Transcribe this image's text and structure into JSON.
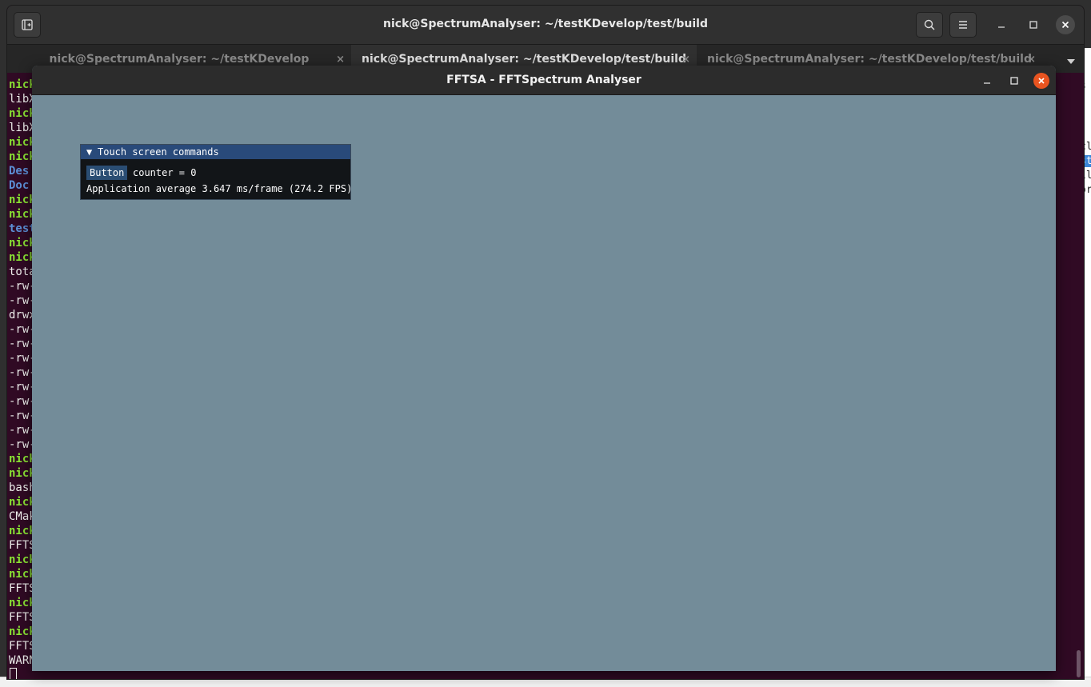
{
  "terminal": {
    "title": "nick@SpectrumAnalyser: ~/testKDevelop/test/build",
    "tabs": [
      {
        "label": "nick@SpectrumAnalyser: ~/testKDevelop",
        "active": false
      },
      {
        "label": "nick@SpectrumAnalyser: ~/testKDevelop/test/build",
        "active": true
      },
      {
        "label": "nick@SpectrumAnalyser: ~/testKDevelop/test/build",
        "active": false
      }
    ],
    "tab_close_glyph": "×",
    "lines": [
      {
        "text": "nick",
        "color": "green"
      },
      {
        "text": "libX",
        "color": "white"
      },
      {
        "text": "nick",
        "color": "green"
      },
      {
        "text": "libX",
        "color": "white"
      },
      {
        "text": "nick",
        "color": "green"
      },
      {
        "text": "nick",
        "color": "green"
      },
      {
        "text": " Des",
        "color": "blue"
      },
      {
        "text": " Doc",
        "color": "blue"
      },
      {
        "text": "nick",
        "color": "green"
      },
      {
        "text": "nick",
        "color": "green"
      },
      {
        "text": "test",
        "color": "blue"
      },
      {
        "text": "nick",
        "color": "green"
      },
      {
        "text": "nick",
        "color": "green"
      },
      {
        "text": "tota",
        "color": "white"
      },
      {
        "text": "-rw-",
        "color": "white"
      },
      {
        "text": "-rw-",
        "color": "white"
      },
      {
        "text": "drwx",
        "color": "white"
      },
      {
        "text": "-rw-",
        "color": "white"
      },
      {
        "text": "-rw-",
        "color": "white"
      },
      {
        "text": "-rw-",
        "color": "white"
      },
      {
        "text": "-rw-",
        "color": "white"
      },
      {
        "text": "-rw-",
        "color": "white"
      },
      {
        "text": "-rw-",
        "color": "white"
      },
      {
        "text": "-rw-",
        "color": "white"
      },
      {
        "text": "-rw-",
        "color": "white"
      },
      {
        "text": "-rw-",
        "color": "white"
      },
      {
        "text": "nick",
        "color": "green"
      },
      {
        "text": "nick",
        "color": "green"
      },
      {
        "text": "bash",
        "color": "white"
      },
      {
        "text": "nick",
        "color": "green"
      },
      {
        "text": "CMak",
        "color": "white"
      },
      {
        "text": "nick",
        "color": "green"
      },
      {
        "text": "FFTS",
        "color": "white"
      },
      {
        "text": "nick",
        "color": "green"
      },
      {
        "text": "nick",
        "color": "green"
      },
      {
        "text": "FFTS",
        "color": "white"
      },
      {
        "text": "nick",
        "color": "green"
      },
      {
        "text": "FFTS",
        "color": "white"
      },
      {
        "text": "nick",
        "color": "green"
      },
      {
        "text": "FFTS",
        "color": "white"
      },
      {
        "text": "WARN",
        "color": "white"
      }
    ],
    "icons": {
      "new_tab": "new-tab-icon",
      "search": "search-icon",
      "menu": "hamburger-menu-icon",
      "minimize": "minimize-icon",
      "maximize": "maximize-icon",
      "close": "close-icon",
      "tab_dropdown": "chevron-down-icon"
    }
  },
  "background_editor": {
    "fragments": [
      "s",
      "cl",
      "st",
      "il",
      "or"
    ]
  },
  "app": {
    "title": "FFTSA - FFTSpectrum Analyser",
    "background_color": "#738c99",
    "close_color": "#e95420",
    "imgui_window": {
      "title": "Touch screen commands",
      "collapse_glyph": "▼",
      "button_label": "Button",
      "counter_text": "counter = 0",
      "fps_text": "Application average 3.647 ms/frame (274.2 FPS)"
    }
  }
}
